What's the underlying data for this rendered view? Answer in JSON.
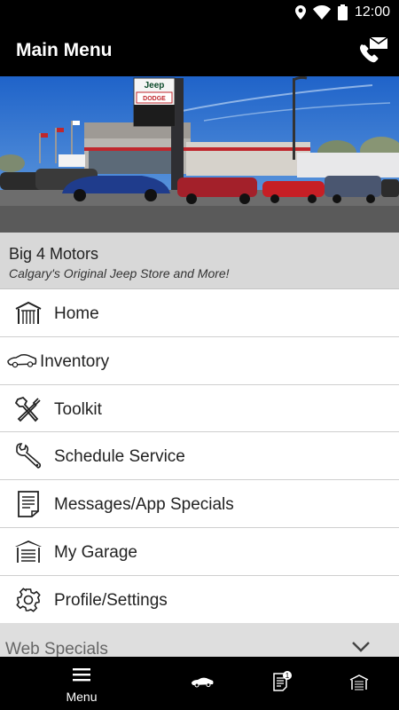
{
  "status_bar": {
    "time": "12:00"
  },
  "app_bar": {
    "title": "Main Menu",
    "contact_icon": "phone-mail-icon"
  },
  "hero": {
    "image": "dealership-lot-photo",
    "signs": {
      "jeep": "Jeep",
      "dodge": "DODGE"
    }
  },
  "dealer": {
    "name": "Big 4 Motors",
    "tagline": "Calgary's Original Jeep Store and More!"
  },
  "menu": {
    "items": [
      {
        "label": "Home",
        "icon": "home-icon"
      },
      {
        "label": "Inventory",
        "icon": "car-icon"
      },
      {
        "label": "Toolkit",
        "icon": "tools-icon"
      },
      {
        "label": "Schedule Service",
        "icon": "wrench-icon"
      },
      {
        "label": "Messages/App Specials",
        "icon": "document-icon"
      },
      {
        "label": "My Garage",
        "icon": "garage-icon"
      },
      {
        "label": "Profile/Settings",
        "icon": "gear-icon"
      }
    ]
  },
  "web_specials": {
    "label": "Web Specials",
    "icon": "chevron-down-icon"
  },
  "bottom_nav": {
    "tabs": [
      {
        "label": "Menu",
        "icon": "hamburger-icon"
      },
      {
        "label": "",
        "icon": "car-icon"
      },
      {
        "label": "",
        "icon": "document-icon",
        "badge": "1"
      },
      {
        "label": "",
        "icon": "garage-icon"
      }
    ]
  },
  "colors": {
    "bar": "#000000",
    "dealer_card": "#d8d8d8",
    "web_specials": "#dedede"
  }
}
